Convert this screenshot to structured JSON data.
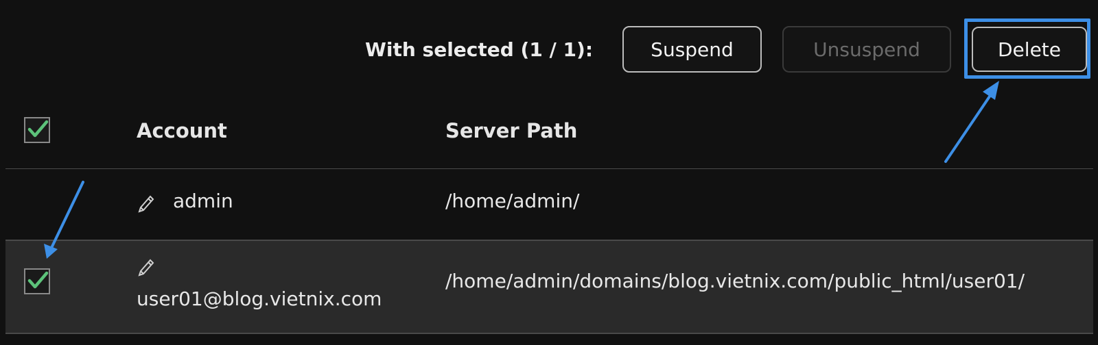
{
  "toolbar": {
    "with_selected_label": "With selected (1 / 1):",
    "suspend_label": "Suspend",
    "unsuspend_label": "Unsuspend",
    "delete_label": "Delete"
  },
  "table": {
    "header": {
      "select_all_checked": true,
      "account": "Account",
      "server_path": "Server Path"
    },
    "rows": [
      {
        "checked": false,
        "account": "admin",
        "server_path": "/home/admin/"
      },
      {
        "checked": true,
        "account": "user01@blog.vietnix.com",
        "server_path": "/home/admin/domains/blog.vietnix.com/public_html/user01/"
      }
    ]
  },
  "icons": {
    "check": "check-icon",
    "edit": "pencil-icon",
    "annotation": "arrow-icon"
  },
  "colors": {
    "background": "#111111",
    "selected_row": "#2a2a2a",
    "check_green": "#5cc27a",
    "annotation_blue": "#3d8fe6",
    "disabled_text": "#6b6b6b"
  }
}
